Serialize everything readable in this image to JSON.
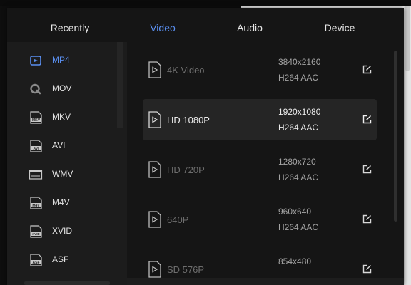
{
  "tabs": [
    {
      "label": "Recently",
      "active": false
    },
    {
      "label": "Video",
      "active": true
    },
    {
      "label": "Audio",
      "active": false
    },
    {
      "label": "Device",
      "active": false
    }
  ],
  "formats": [
    {
      "label": "MP4",
      "icon": "video-camera-icon",
      "active": true
    },
    {
      "label": "MOV",
      "icon": "quicktime-icon",
      "active": false
    },
    {
      "label": "MKV",
      "icon": "mkv-file-icon",
      "active": false
    },
    {
      "label": "AVI",
      "icon": "avi-file-icon",
      "active": false
    },
    {
      "label": "WMV",
      "icon": "wmv-file-icon",
      "active": false
    },
    {
      "label": "M4V",
      "icon": "m4v-file-icon",
      "active": false
    },
    {
      "label": "XVID",
      "icon": "xvid-file-icon",
      "active": false
    },
    {
      "label": "ASF",
      "icon": "asf-file-icon",
      "active": false
    }
  ],
  "presets": [
    {
      "name": "4K Video",
      "resolution": "3840x2160",
      "codec": "H264  AAC",
      "selected": false
    },
    {
      "name": "HD 1080P",
      "resolution": "1920x1080",
      "codec": "H264  AAC",
      "selected": true
    },
    {
      "name": "HD 720P",
      "resolution": "1280x720",
      "codec": "H264  AAC",
      "selected": false
    },
    {
      "name": "640P",
      "resolution": "960x640",
      "codec": "H264  AAC",
      "selected": false
    },
    {
      "name": "SD 576P",
      "resolution": "854x480",
      "codec": "",
      "selected": false
    }
  ],
  "colors": {
    "accent": "#5a8ff0",
    "panel": "#151515",
    "sidebar": "#1c1c1c",
    "selected_row": "#252525"
  }
}
